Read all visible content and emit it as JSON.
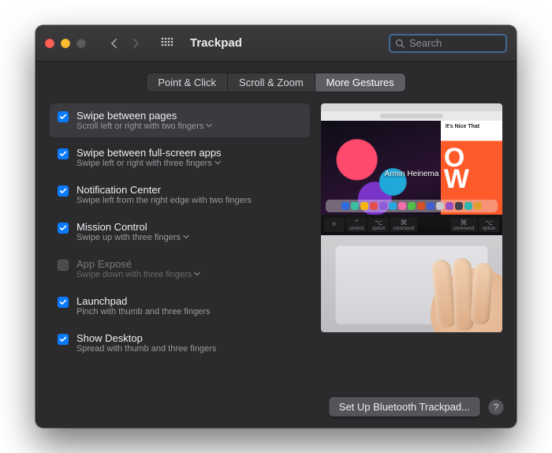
{
  "window": {
    "title": "Trackpad"
  },
  "search": {
    "placeholder": "Search"
  },
  "tabs": [
    {
      "label": "Point & Click",
      "active": false
    },
    {
      "label": "Scroll & Zoom",
      "active": false
    },
    {
      "label": "More Gestures",
      "active": true
    }
  ],
  "options": [
    {
      "title": "Swipe between pages",
      "subtitle": "Scroll left or right with two fingers",
      "checked": true,
      "has_menu": true,
      "selected": true,
      "enabled": true
    },
    {
      "title": "Swipe between full-screen apps",
      "subtitle": "Swipe left or right with three fingers",
      "checked": true,
      "has_menu": true,
      "selected": false,
      "enabled": true
    },
    {
      "title": "Notification Center",
      "subtitle": "Swipe left from the right edge with two fingers",
      "checked": true,
      "has_menu": false,
      "selected": false,
      "enabled": true
    },
    {
      "title": "Mission Control",
      "subtitle": "Swipe up with three fingers",
      "checked": true,
      "has_menu": true,
      "selected": false,
      "enabled": true
    },
    {
      "title": "App Exposé",
      "subtitle": "Swipe down with three fingers",
      "checked": false,
      "has_menu": true,
      "selected": false,
      "enabled": false
    },
    {
      "title": "Launchpad",
      "subtitle": "Pinch with thumb and three fingers",
      "checked": true,
      "has_menu": false,
      "selected": false,
      "enabled": true
    },
    {
      "title": "Show Desktop",
      "subtitle": "Spread with thumb and three fingers",
      "checked": true,
      "has_menu": false,
      "selected": false,
      "enabled": true
    }
  ],
  "preview": {
    "caption": "Armin Heinema",
    "side_tag": "It's Nice That",
    "side_big1": "O",
    "side_big2": "W",
    "keys": {
      "left1": "fn",
      "left2": "control",
      "left3": "option",
      "left4": "command",
      "right1": "command",
      "right2": "option"
    }
  },
  "footer": {
    "setup_label": "Set Up Bluetooth Trackpad...",
    "help": "?"
  },
  "dock_colors": [
    "#2d6cdf",
    "#3ac0a0",
    "#f5b70f",
    "#e44d4d",
    "#8f5bd8",
    "#2aa7e0",
    "#f06ea9",
    "#50c04a",
    "#d84f2a",
    "#4060d0",
    "#c8c8cc",
    "#9a50c0",
    "#404048",
    "#30b8b0",
    "#e0a030"
  ]
}
